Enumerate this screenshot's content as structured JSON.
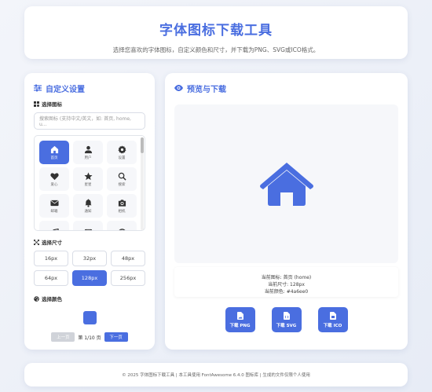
{
  "header": {
    "title": "字体图标下载工具",
    "subtitle": "选择您喜欢的字体图标，自定义颜色和尺寸，并下载为PNG、SVG或ICO格式。"
  },
  "settings": {
    "title": "自定义设置",
    "icon_label": "选择图标",
    "search_placeholder": "搜索图标 (支持中文/英文，如: 首页, home, u...",
    "icons": [
      {
        "label": "首页",
        "icon": "home-icon",
        "active": true
      },
      {
        "label": "用户",
        "icon": "user-icon",
        "active": false
      },
      {
        "label": "设置",
        "icon": "gear-icon",
        "active": false
      },
      {
        "label": "爱心",
        "icon": "heart-icon",
        "active": false
      },
      {
        "label": "星星",
        "icon": "star-icon",
        "active": false
      },
      {
        "label": "搜索",
        "icon": "search-icon",
        "active": false
      },
      {
        "label": "邮箱",
        "icon": "envelope-icon",
        "active": false
      },
      {
        "label": "通知",
        "icon": "bell-icon",
        "active": false
      },
      {
        "label": "相机",
        "icon": "camera-icon",
        "active": false
      },
      {
        "label": "",
        "icon": "music-icon",
        "active": false
      },
      {
        "label": "",
        "icon": "film-icon",
        "active": false
      },
      {
        "label": "",
        "icon": "globe-icon",
        "active": false
      }
    ],
    "size_label": "选择尺寸",
    "sizes": [
      "16px",
      "32px",
      "48px",
      "64px",
      "128px",
      "256px"
    ],
    "selected_size": "128px",
    "color_label": "选择颜色",
    "color": "#4a6ee0",
    "prev_label": "上一页",
    "page_text": "第 1/10 页",
    "next_label": "下一页"
  },
  "preview": {
    "title": "预览与下载",
    "current_icon": "当前图标: 首页 (home)",
    "current_size": "当前尺寸: 128px",
    "current_color": "当前颜色: #4a6ee0",
    "downloads": [
      "下载 PNG",
      "下载 SVG",
      "下载 ICO"
    ]
  },
  "footer": {
    "text": "© 2025 字体图标下载工具 | 本工具使用 FontAwesome 6.4.0 图标库 | 生成的文件仅限个人使用"
  }
}
